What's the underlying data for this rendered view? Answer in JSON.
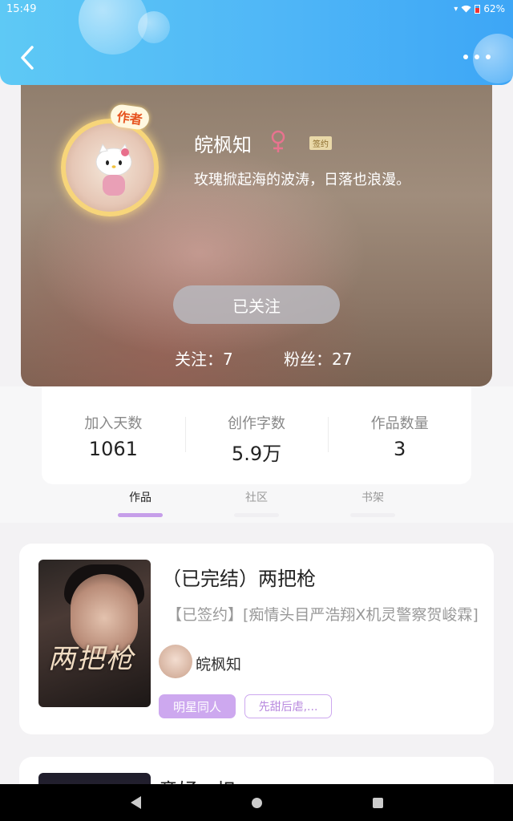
{
  "status_bar": {
    "time": "15:49",
    "battery": "62%"
  },
  "header": {
    "back_icon": "chevron-left-icon",
    "more_icon": "more-dots-icon"
  },
  "profile": {
    "author_tag": "作者",
    "name": "皖枫知",
    "gender_icon": "female-icon",
    "signed_badge": "签约",
    "motto": "玫瑰掀起海的波涛，日落也浪漫。",
    "follow_button": "已关注",
    "following": "关注：7",
    "fans": "粉丝：27"
  },
  "stats": [
    {
      "label": "加入天数",
      "value": "1061"
    },
    {
      "label": "创作字数",
      "value": "5.9万"
    },
    {
      "label": "作品数量",
      "value": "3"
    }
  ],
  "tabs": [
    {
      "label": "作品",
      "active": true
    },
    {
      "label": "社区",
      "active": false
    },
    {
      "label": "书架",
      "active": false
    }
  ],
  "books": [
    {
      "title": "（已完结）两把枪",
      "description": "【已签约】[痴情头目严浩翔X机灵警察贺峻霖]",
      "cover_text": "两把枪",
      "author": "皖枫知",
      "tags": [
        "明星同人",
        "先甜后虐,..."
      ]
    },
    {
      "title": "意妤：炽"
    }
  ],
  "colors": {
    "header_gradient_start": "#5ec9f5",
    "header_gradient_end": "#3da6f6",
    "accent_purple": "#cda8ef",
    "gender_pink": "#e8738f"
  }
}
